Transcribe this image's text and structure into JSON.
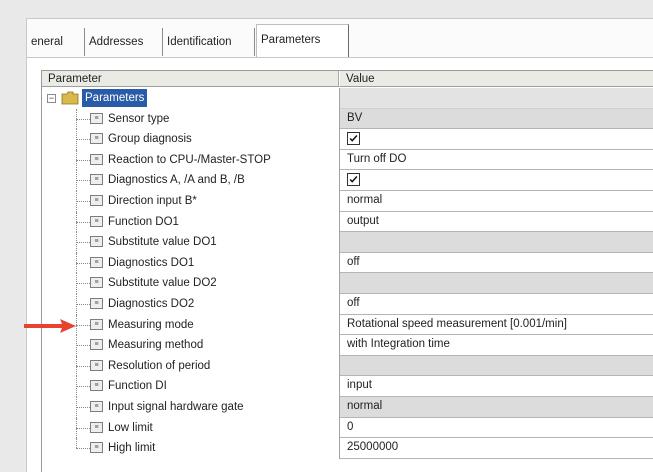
{
  "tabs": [
    "eneral",
    "Addresses",
    "Identification",
    "Parameters"
  ],
  "active_tab": "Parameters",
  "grid": {
    "columns": [
      "Parameter",
      "Value"
    ],
    "root": {
      "label": "Parameters"
    },
    "rows": [
      {
        "name": "Sensor type",
        "value": "BV",
        "bg": "gray"
      },
      {
        "name": "Group diagnosis",
        "checkbox": true,
        "bg": "white"
      },
      {
        "name": "Reaction to CPU-/Master-STOP",
        "value": "Turn off DO",
        "bg": "white"
      },
      {
        "name": "Diagnostics A, /A and B, /B",
        "checkbox": true,
        "bg": "white"
      },
      {
        "name": "Direction input B*",
        "value": "normal",
        "bg": "white"
      },
      {
        "name": "Function DO1",
        "value": "output",
        "bg": "white"
      },
      {
        "name": "Substitute value DO1",
        "value": "",
        "bg": "gray"
      },
      {
        "name": "Diagnostics DO1",
        "value": "off",
        "bg": "white"
      },
      {
        "name": "Substitute value DO2",
        "value": "",
        "bg": "gray"
      },
      {
        "name": "Diagnostics DO2",
        "value": "off",
        "bg": "white"
      },
      {
        "name": "Measuring mode",
        "value": "Rotational speed measurement [0.001/min]",
        "bg": "white"
      },
      {
        "name": "Measuring method",
        "value": "with Integration time",
        "bg": "white"
      },
      {
        "name": "Resolution of period",
        "value": "",
        "bg": "gray"
      },
      {
        "name": "Function DI",
        "value": "input",
        "bg": "white"
      },
      {
        "name": "Input signal hardware gate",
        "value": "normal",
        "bg": "gray"
      },
      {
        "name": "Low limit",
        "value": "0",
        "bg": "white"
      },
      {
        "name": "High limit",
        "value": "25000000",
        "bg": "white"
      }
    ]
  },
  "colors": {
    "arrow": "#e8432f",
    "selection": "#2a5ba8",
    "folder": "#d9b94a"
  },
  "icons": {
    "row_icon": "parameter-node-icon",
    "root_icon": "folder-icon",
    "pointer": "red-arrow-icon"
  },
  "highlighted_row": "Measuring mode"
}
